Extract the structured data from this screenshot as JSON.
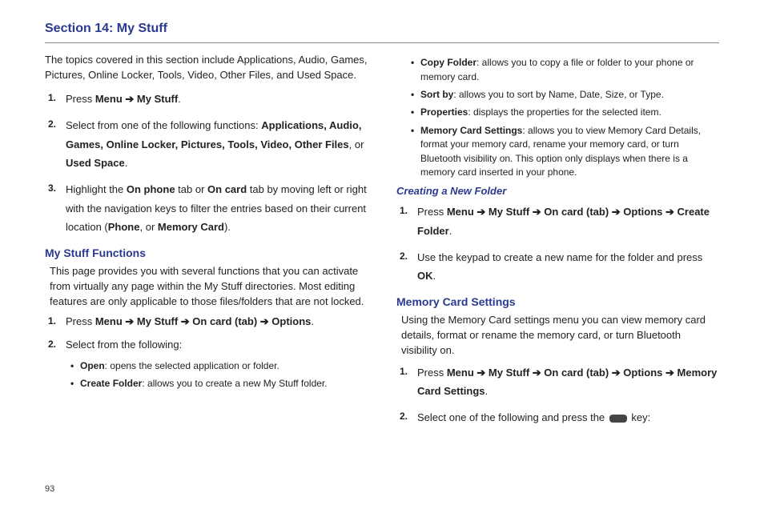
{
  "section_title": "Section 14: My Stuff",
  "left": {
    "intro": "The topics covered in this section include Applications, Audio, Games, Pictures, Online Locker, Tools, Video, Other Files, and Used Space.",
    "steps_a": {
      "s1_pre": "Press ",
      "s1_bold": "Menu ➔ My Stuff",
      "s2_pre": "Select from one of the following functions: ",
      "s2_list": "Applications, Audio, Games, Online Locker, Pictures, Tools, Video, Other Files",
      "s2_or": ", or ",
      "s2_last": "Used Space",
      "s3_a": "Highlight the ",
      "s3_b": "On phone",
      "s3_c": " tab or ",
      "s3_d": "On card",
      "s3_e": " tab by moving left or right with the navigation keys to filter the entries based on their current location (",
      "s3_f": "Phone",
      "s3_g": ", or ",
      "s3_h": "Memory Card",
      "s3_i": ")."
    },
    "h2": "My Stuff Functions",
    "func_intro": "This page provides you with several functions that you can activate from virtually any page within the My Stuff directories. Most editing features are only applicable to those files/folders that are not locked.",
    "steps_b": {
      "s1_pre": "Press ",
      "s1_bold": "Menu ➔ My Stuff ➔ On card (tab) ➔ Options",
      "s2": "Select from the following:"
    },
    "bullets_b": [
      {
        "b": "Open",
        "t": ": opens the selected application or folder."
      },
      {
        "b": "Create Folder",
        "t": ": allows you to create a new My Stuff folder."
      }
    ]
  },
  "right": {
    "bullets_top": [
      {
        "b": "Copy Folder",
        "t": ": allows you to copy a file or folder to your phone or memory card."
      },
      {
        "b": "Sort by",
        "t": ": allows you to sort by Name, Date, Size, or Type."
      },
      {
        "b": "Properties",
        "t": ": displays the properties for the selected item."
      },
      {
        "b": "Memory Card Settings",
        "t": ": allows you to view Memory Card Details, format your memory card, rename your memory card, or turn Bluetooth visibility on. This option only displays when there is a memory card inserted in your phone."
      }
    ],
    "h3": "Creating a New Folder",
    "steps_c": {
      "s1_pre": "Press ",
      "s1_bold": "Menu ➔ My Stuff ➔ On card (tab) ➔ Options ➔ Create Folder",
      "s2_a": "Use the keypad to create a new name for the folder and press ",
      "s2_b": "OK"
    },
    "h2": "Memory Card Settings",
    "mem_intro": "Using the Memory Card settings menu you can view memory card details, format or rename the memory card, or turn Bluetooth visibility on.",
    "steps_d": {
      "s1_pre": "Press ",
      "s1_bold": "Menu ➔ My Stuff ➔ On card (tab) ➔ Options ➔ Memory Card Settings",
      "s2_a": "Select one of the following and press the ",
      "s2_b": " key:"
    }
  },
  "page": "93"
}
